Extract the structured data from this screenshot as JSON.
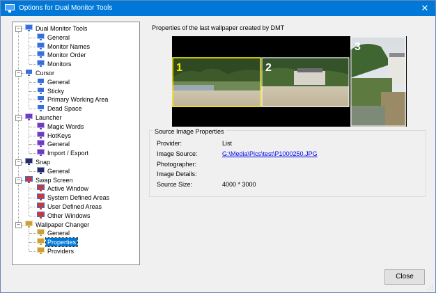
{
  "window": {
    "title": "Options for Dual Monitor Tools",
    "close_glyph": "✕"
  },
  "tree": {
    "groups": [
      {
        "label": "Dual Monitor Tools",
        "icon": "monitor-icon",
        "children": [
          "General",
          "Monitor Names",
          "Monitor Order",
          "Monitors"
        ]
      },
      {
        "label": "Cursor",
        "icon": "cursor-icon",
        "children": [
          "General",
          "Sticky",
          "Primary Working Area",
          "Dead Space"
        ]
      },
      {
        "label": "Launcher",
        "icon": "launcher-icon",
        "children": [
          "Magic Words",
          "HotKeys",
          "General",
          "Import / Export"
        ]
      },
      {
        "label": "Snap",
        "icon": "snap-icon",
        "children": [
          "General"
        ]
      },
      {
        "label": "Swap Screen",
        "icon": "swap-screen-icon",
        "children": [
          "Active Window",
          "System Defined Areas",
          "User Defined Areas",
          "Other Windows"
        ]
      },
      {
        "label": "Wallpaper Changer",
        "icon": "wallpaper-icon",
        "children": [
          "General",
          "Properties",
          "Providers"
        ]
      }
    ],
    "selected": "Properties"
  },
  "preview": {
    "heading": "Properties of the last wallpaper created by DMT",
    "monitors": [
      "1",
      "2",
      "3"
    ],
    "colors": {
      "monitor1_border": "#ffe800",
      "monitor_border": "#ffffff",
      "background": "#000000"
    }
  },
  "source_props": {
    "title": "Source Image Properties",
    "rows": [
      {
        "label": "Provider:",
        "value": "List",
        "link": false
      },
      {
        "label": "Image Source:",
        "value": "G:\\Media\\Pics\\test\\P1000250.JPG",
        "link": true
      },
      {
        "label": "Photographer:",
        "value": "",
        "link": false
      },
      {
        "label": "Image Details:",
        "value": "",
        "link": false
      },
      {
        "label": "Source Size:",
        "value": "4000 * 3000",
        "link": false
      }
    ]
  },
  "buttons": {
    "close": "Close"
  },
  "colors": {
    "accent": "#0078d7",
    "link": "#0000ee"
  }
}
